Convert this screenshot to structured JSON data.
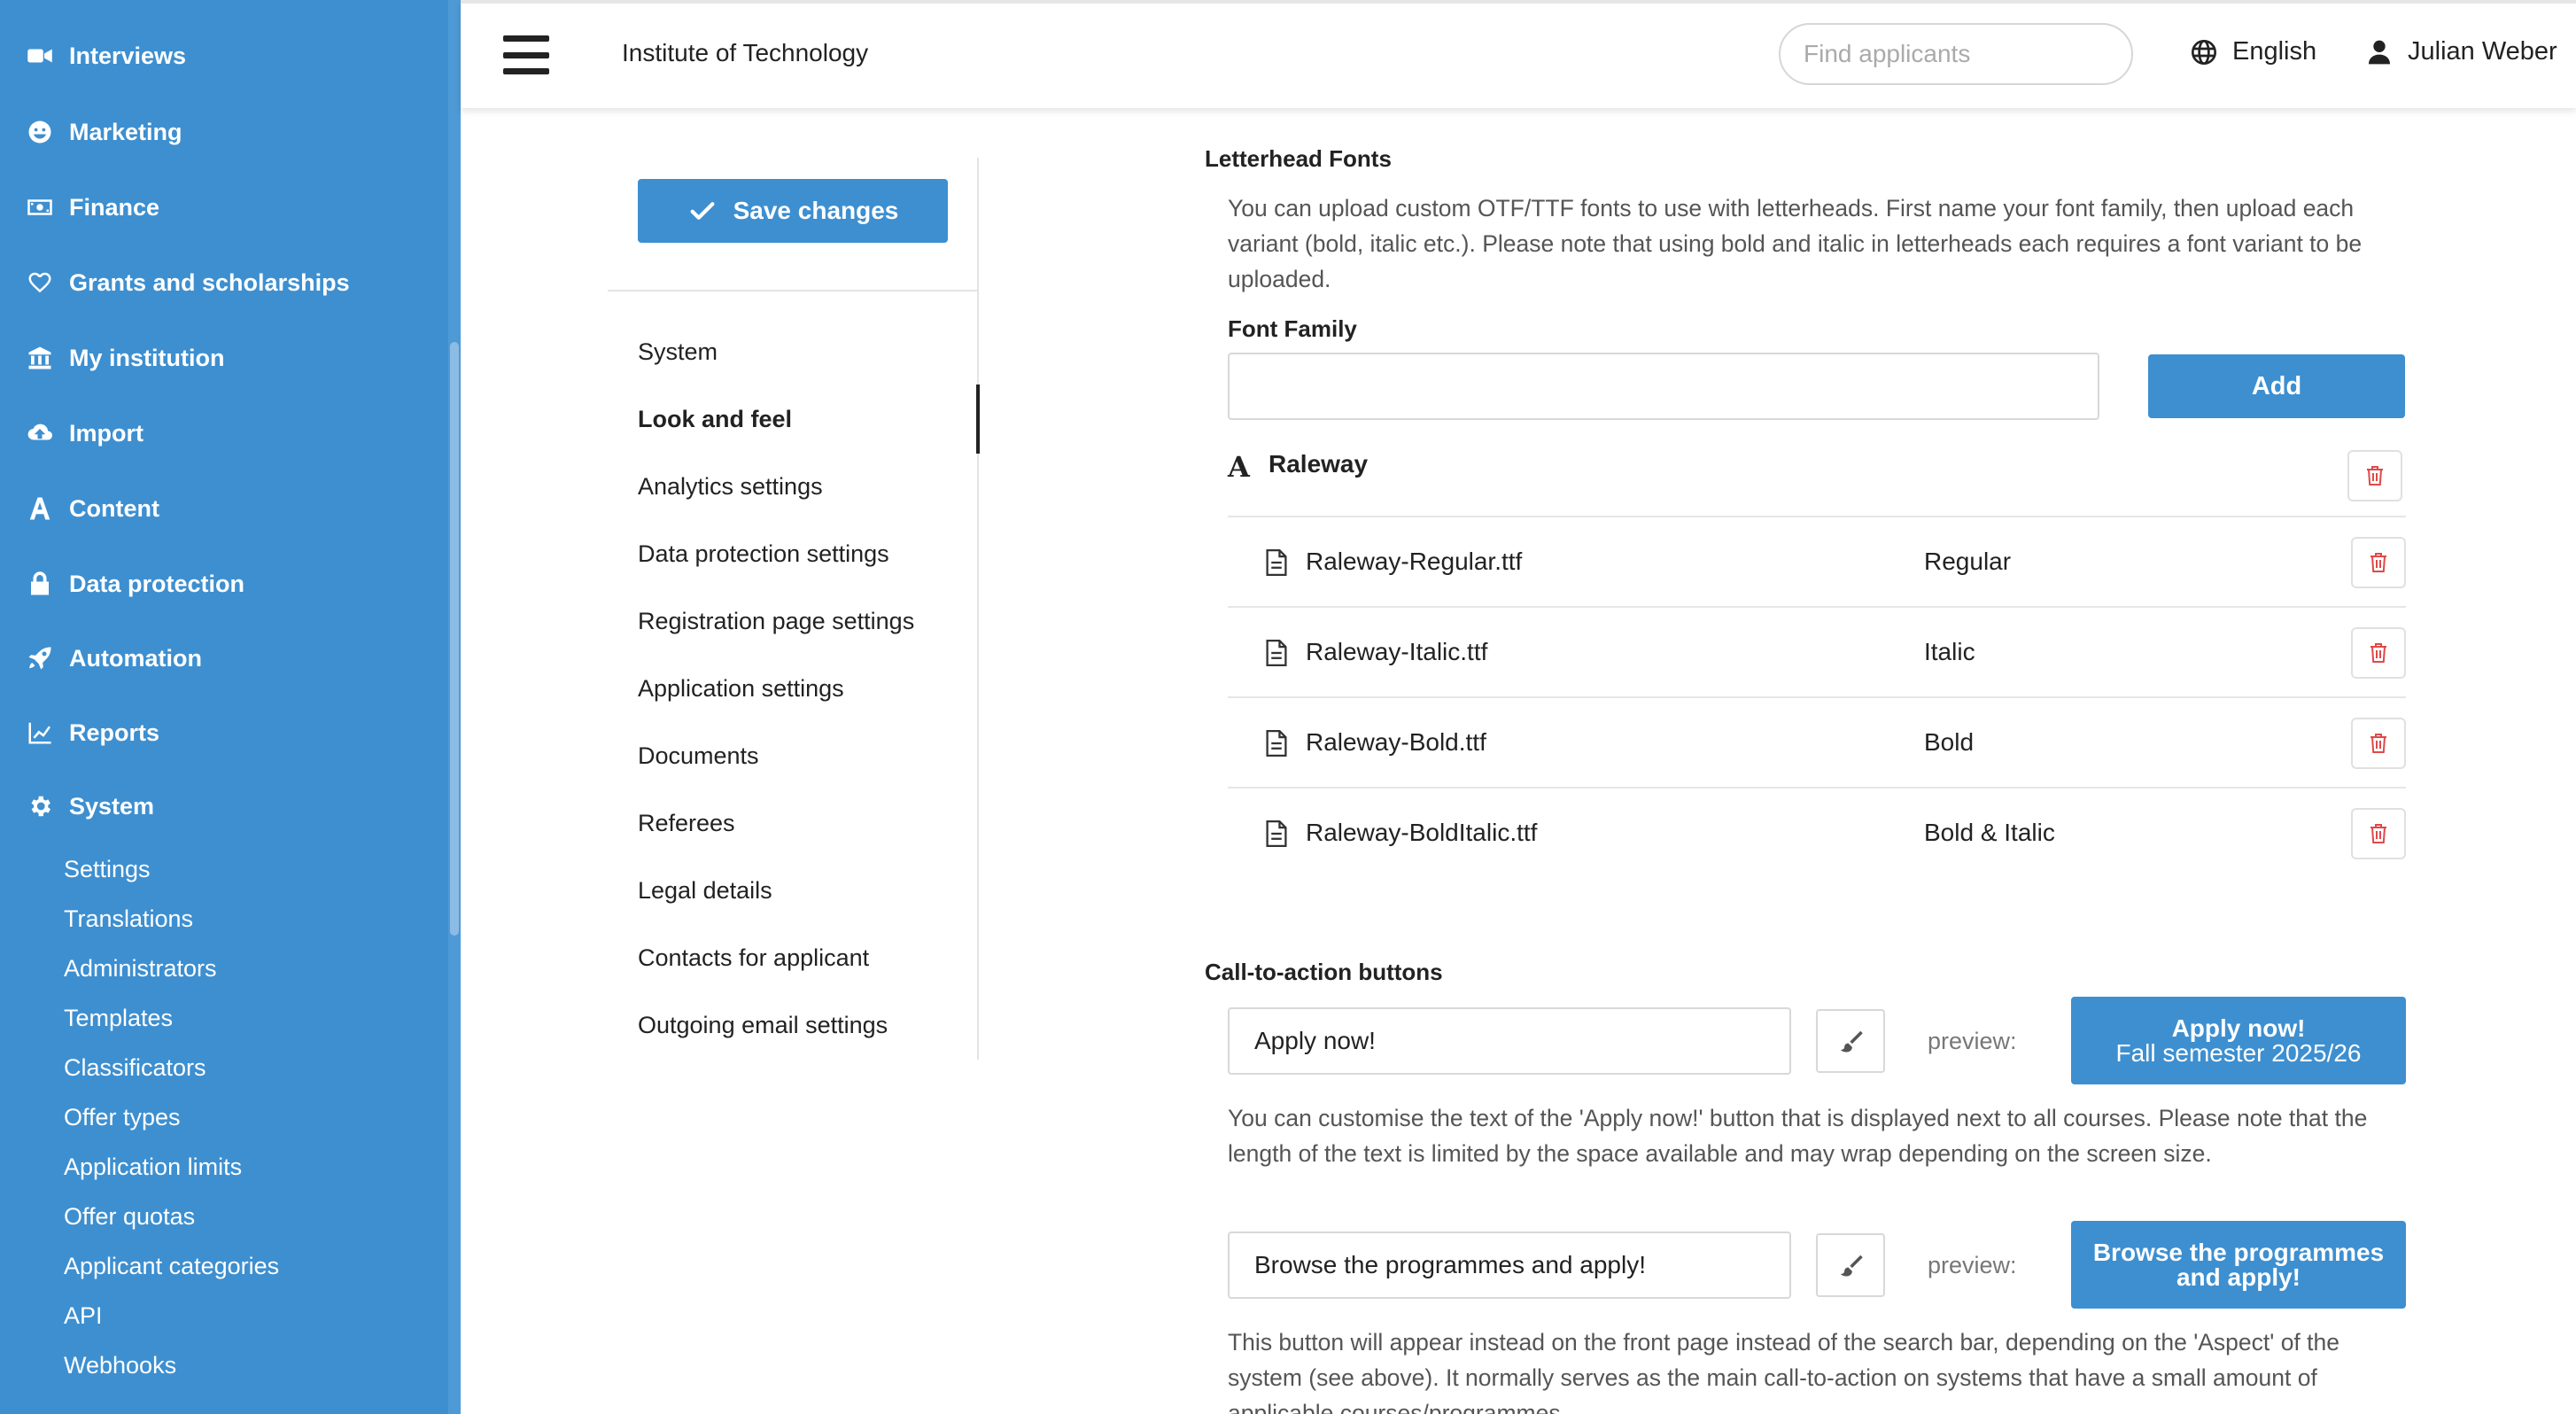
{
  "sidebar": {
    "items": [
      {
        "label": "Interviews",
        "icon": "video-camera-icon"
      },
      {
        "label": "Marketing",
        "icon": "smiley-icon"
      },
      {
        "label": "Finance",
        "icon": "money-bill-icon"
      },
      {
        "label": "Grants and scholarships",
        "icon": "heart-icon"
      },
      {
        "label": "My institution",
        "icon": "bank-icon"
      },
      {
        "label": "Import",
        "icon": "cloud-upload-icon"
      },
      {
        "label": "Content",
        "icon": "letter-a-icon"
      },
      {
        "label": "Data protection",
        "icon": "lock-icon"
      },
      {
        "label": "Automation",
        "icon": "rocket-icon"
      },
      {
        "label": "Reports",
        "icon": "line-chart-icon"
      },
      {
        "label": "System",
        "icon": "gear-icon"
      }
    ],
    "system_subitems": [
      "Settings",
      "Translations",
      "Administrators",
      "Templates",
      "Classificators",
      "Offer types",
      "Application limits",
      "Offer quotas",
      "Applicant categories",
      "API",
      "Webhooks"
    ]
  },
  "header": {
    "institution": "Institute of Technology",
    "search_placeholder": "Find applicants",
    "language": "English",
    "user": "Julian Weber"
  },
  "settings_menu": {
    "save_label": "Save changes",
    "items": [
      "System",
      "Look and feel",
      "Analytics settings",
      "Data protection settings",
      "Registration page settings",
      "Application settings",
      "Documents",
      "Referees",
      "Legal details",
      "Contacts for applicant",
      "Outgoing email settings"
    ],
    "active": "Look and feel"
  },
  "letterhead": {
    "title": "Letterhead Fonts",
    "description": "You can upload custom OTF/TTF fonts to use with letterheads. First name your font family, then upload each variant (bold, italic etc.). Please note that using bold and italic in letterheads each requires a font variant to be uploaded.",
    "font_family_label": "Font Family",
    "font_family_value": "",
    "add_label": "Add",
    "family_icon": "A",
    "family_name": "Raleway",
    "variants": [
      {
        "file": "Raleway-Regular.ttf",
        "type": "Regular"
      },
      {
        "file": "Raleway-Italic.ttf",
        "type": "Italic"
      },
      {
        "file": "Raleway-Bold.ttf",
        "type": "Bold"
      },
      {
        "file": "Raleway-BoldItalic.ttf",
        "type": "Bold & Italic"
      }
    ]
  },
  "cta": {
    "title": "Call-to-action buttons",
    "preview_label": "preview:",
    "buttons": [
      {
        "value": "Apply now!",
        "preview_line1": "Apply now!",
        "preview_line2": "Fall semester 2025/26",
        "description": "You can customise the text of the 'Apply now!' button that is displayed next to all courses. Please note that the length of the text is limited by the space available and may wrap depending on the screen size."
      },
      {
        "value": "Browse the programmes and apply!",
        "preview_line1": "Browse the programmes",
        "preview_line2": "and apply!",
        "description": "This button will appear instead on the front page instead of the search bar, depending on the 'Aspect' of the system (see above). It normally serves as the main call-to-action on systems that have a small amount of applicable courses/programmes."
      }
    ]
  },
  "colors": {
    "primary": "#3d8fd0",
    "danger": "#e04848"
  }
}
